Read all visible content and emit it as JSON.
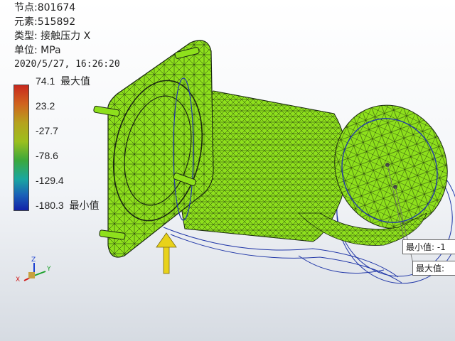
{
  "info": {
    "node": "节点:801674",
    "element": "元素:515892",
    "type": "类型: 接触压力 X",
    "unit": "单位: MPa",
    "timestamp": "2020/5/27, 16:26:20"
  },
  "legend": {
    "max_label": "最大值",
    "min_label": "最小值",
    "ticks": [
      "74.1",
      "23.2",
      "-27.7",
      "-78.6",
      "-129.4",
      "-180.3"
    ],
    "colors": [
      "#c8281e",
      "#d0641e",
      "#b6a21e",
      "#9bbf1e",
      "#3ca83c",
      "#1aa7a0",
      "#1a5fb8",
      "#1222a8"
    ]
  },
  "tooltips": {
    "min": "最小值: -1",
    "max": "最大值:"
  },
  "triad": {
    "x": "X",
    "y": "Y",
    "z": "Z"
  },
  "colors": {
    "mesh_fill": "#8ee01c",
    "mesh_line": "#1a2a10",
    "outline": "#2238a8",
    "arrow": "#e8d21a"
  }
}
